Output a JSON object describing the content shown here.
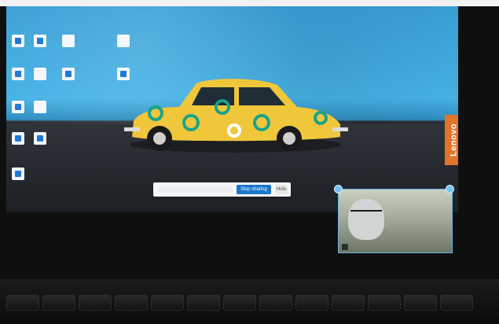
{
  "screen": {
    "brand_sidebar_text": "Lenovo"
  },
  "share_bar": {
    "stop_sharing_label": "Stop sharing",
    "hide_label": "Hide"
  },
  "video_tile": {
    "participant_name": ""
  }
}
